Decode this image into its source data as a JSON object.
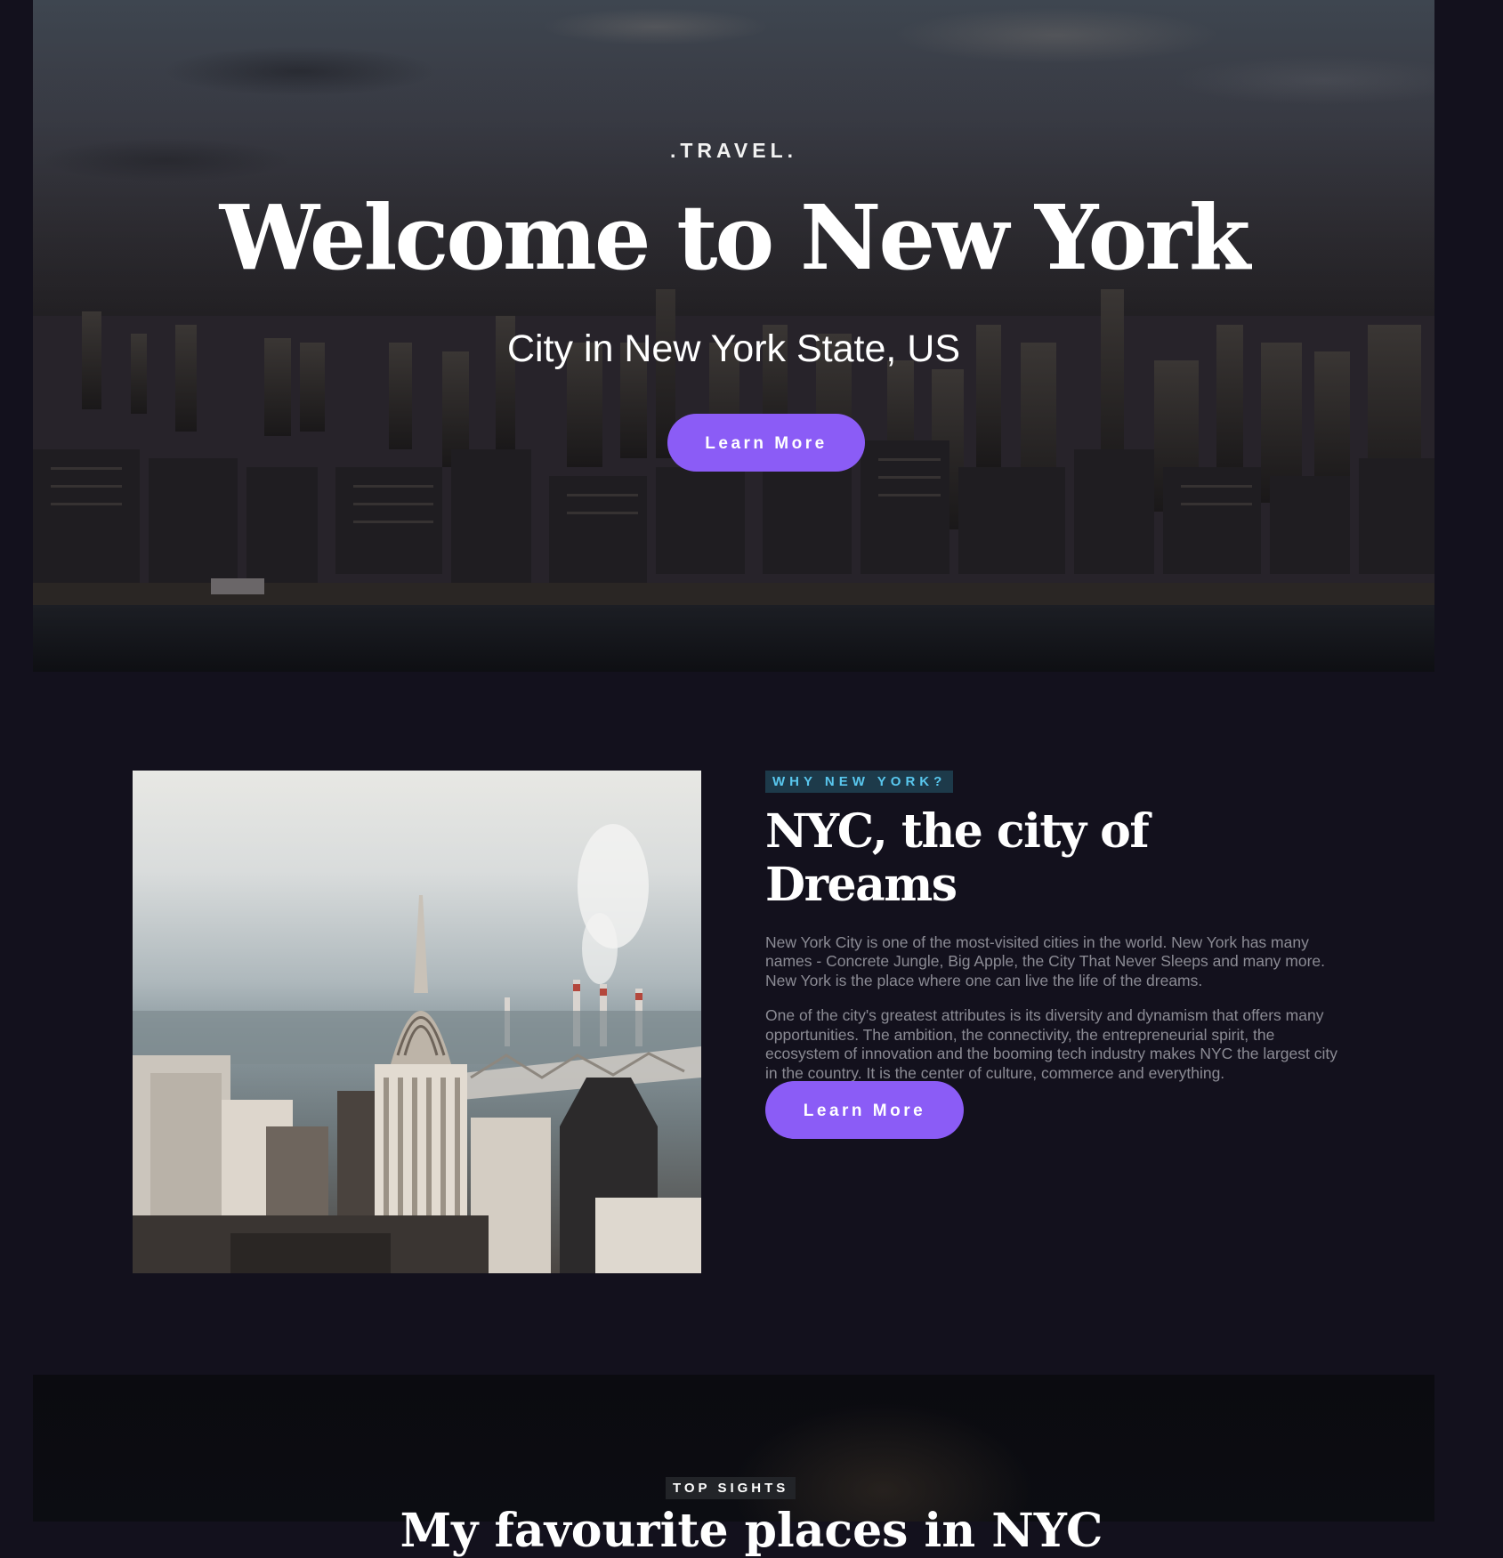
{
  "hero": {
    "eyebrow": ".TRAVEL.",
    "title": "Welcome to New York",
    "subtitle": "City in New York State, US",
    "button_label": "Learn More"
  },
  "about": {
    "tag": "WHY NEW YORK?",
    "heading": "NYC, the city of Dreams",
    "paragraphs": [
      "New York City is one of the most-visited cities in the world. New York has many names - Concrete Jungle, Big Apple, the City That Never Sleeps and many more. New York is the place where one can live the life of the dreams.",
      "One of the city's greatest attributes is its diversity and dynamism that offers many opportunities. The ambition, the connectivity, the entrepreneurial spirit, the ecosystem of innovation and the booming tech industry makes NYC the largest city in the country. It is the center of culture, commerce and everything."
    ],
    "button_label": "Learn More"
  },
  "sights": {
    "tag": "TOP SIGHTS",
    "heading": "My favourite places in NYC"
  },
  "colors": {
    "background": "#13111d",
    "accent": "#8b5cf6",
    "tag_cyan": "#59c7ee",
    "text_muted": "#8b8b94"
  }
}
